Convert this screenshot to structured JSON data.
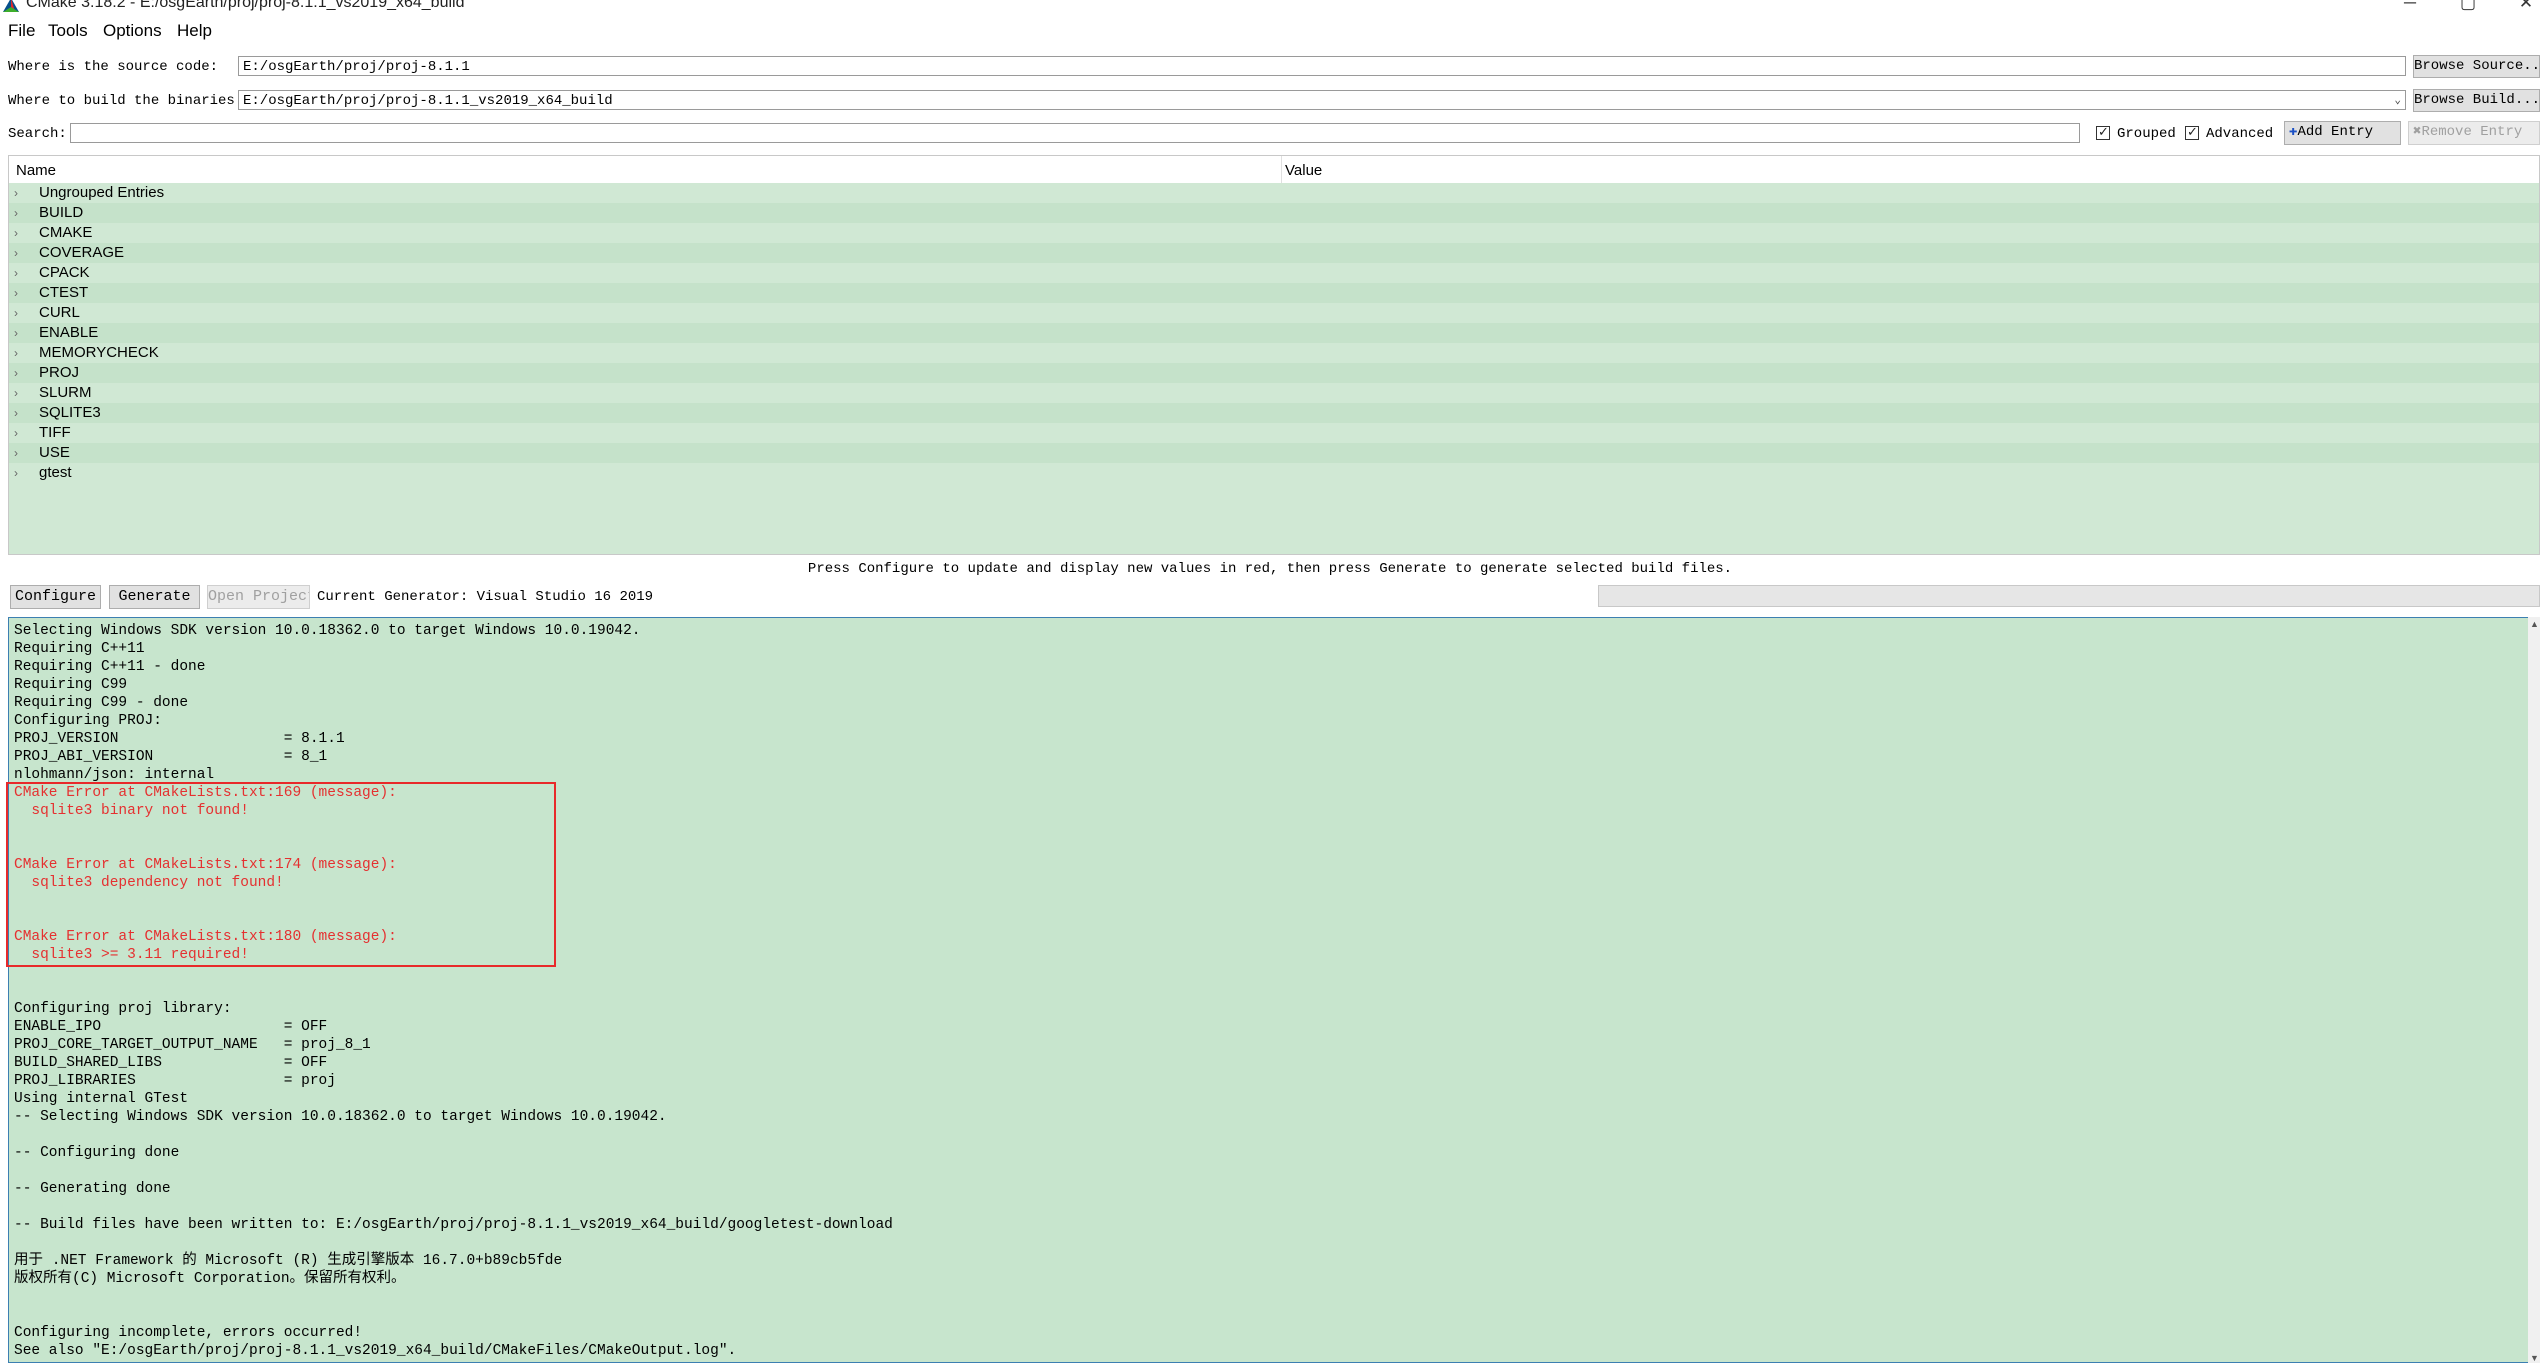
{
  "window": {
    "title": "CMake 3.18.2 - E:/osgEarth/proj/proj-8.1.1_vs2019_x64_build",
    "controls": [
      "─",
      "▢",
      "✕"
    ]
  },
  "menu": [
    "File",
    "Tools",
    "Options",
    "Help"
  ],
  "source": {
    "label": "Where is the source code:",
    "value": "E:/osgEarth/proj/proj-8.1.1",
    "browse": "Browse Source..."
  },
  "build": {
    "label": "Where to build the binaries:",
    "value": "E:/osgEarth/proj/proj-8.1.1_vs2019_x64_build",
    "browse": "Browse Build..."
  },
  "search": {
    "label": "Search:",
    "value": "",
    "grouped": "Grouped",
    "advanced": "Advanced",
    "add_entry": "Add Entry",
    "remove_entry": "Remove Entry"
  },
  "tree": {
    "col_name": "Name",
    "col_value": "Value",
    "groups": [
      "Ungrouped Entries",
      "BUILD",
      "CMAKE",
      "COVERAGE",
      "CPACK",
      "CTEST",
      "CURL",
      "ENABLE",
      "MEMORYCHECK",
      "PROJ",
      "SLURM",
      "SQLITE3",
      "TIFF",
      "USE",
      "gtest"
    ]
  },
  "hint": "Press Configure to update and display new values in red, then press Generate to generate selected build files.",
  "actions": {
    "configure": "Configure",
    "generate": "Generate",
    "open_project": "Open Project",
    "generator": "Current Generator: Visual Studio 16 2019",
    "progress": 0
  },
  "log": [
    {
      "text": "Selecting Windows SDK version 10.0.18362.0 to target Windows 10.0.19042.",
      "error": false
    },
    {
      "text": "Requiring C++11",
      "error": false
    },
    {
      "text": "Requiring C++11 - done",
      "error": false
    },
    {
      "text": "Requiring C99",
      "error": false
    },
    {
      "text": "Requiring C99 - done",
      "error": false
    },
    {
      "text": "Configuring PROJ:",
      "error": false
    },
    {
      "text": "PROJ_VERSION                   = 8.1.1",
      "error": false
    },
    {
      "text": "PROJ_ABI_VERSION               = 8_1",
      "error": false
    },
    {
      "text": "nlohmann/json: internal",
      "error": false
    },
    {
      "text": "CMake Error at CMakeLists.txt:169 (message):",
      "error": true
    },
    {
      "text": "  sqlite3 binary not found!",
      "error": true
    },
    {
      "text": "",
      "error": true
    },
    {
      "text": "",
      "error": true
    },
    {
      "text": "CMake Error at CMakeLists.txt:174 (message):",
      "error": true
    },
    {
      "text": "  sqlite3 dependency not found!",
      "error": true
    },
    {
      "text": "",
      "error": true
    },
    {
      "text": "",
      "error": true
    },
    {
      "text": "CMake Error at CMakeLists.txt:180 (message):",
      "error": true
    },
    {
      "text": "  sqlite3 >= 3.11 required!",
      "error": true
    },
    {
      "text": "",
      "error": false
    },
    {
      "text": "",
      "error": false
    },
    {
      "text": "Configuring proj library:",
      "error": false
    },
    {
      "text": "ENABLE_IPO                     = OFF",
      "error": false
    },
    {
      "text": "PROJ_CORE_TARGET_OUTPUT_NAME   = proj_8_1",
      "error": false
    },
    {
      "text": "BUILD_SHARED_LIBS              = OFF",
      "error": false
    },
    {
      "text": "PROJ_LIBRARIES                 = proj",
      "error": false
    },
    {
      "text": "Using internal GTest",
      "error": false
    },
    {
      "text": "-- Selecting Windows SDK version 10.0.18362.0 to target Windows 10.0.19042.",
      "error": false
    },
    {
      "text": "",
      "error": false
    },
    {
      "text": "-- Configuring done",
      "error": false
    },
    {
      "text": "",
      "error": false
    },
    {
      "text": "-- Generating done",
      "error": false
    },
    {
      "text": "",
      "error": false
    },
    {
      "text": "-- Build files have been written to: E:/osgEarth/proj/proj-8.1.1_vs2019_x64_build/googletest-download",
      "error": false
    },
    {
      "text": "",
      "error": false
    },
    {
      "text": "用于 .NET Framework 的 Microsoft (R) 生成引擎版本 16.7.0+b89cb5fde",
      "error": false
    },
    {
      "text": "版权所有(C) Microsoft Corporation。保留所有权利。",
      "error": false
    },
    {
      "text": "",
      "error": false
    },
    {
      "text": "",
      "error": false
    },
    {
      "text": "Configuring incomplete, errors occurred!",
      "error": false
    },
    {
      "text": "See also \"E:/osgEarth/proj/proj-8.1.1_vs2019_x64_build/CMakeFiles/CMakeOutput.log\".",
      "error": false
    }
  ],
  "colors": {
    "tree_bg": "#d0e8d4",
    "log_bg": "#c7e5cd",
    "error_text": "#e53030",
    "error_box": "#e8292a"
  }
}
